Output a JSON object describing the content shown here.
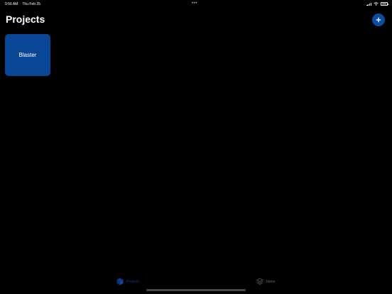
{
  "status_bar": {
    "time": "9:56 AM",
    "date": "Thu Feb 25",
    "dots": "•••",
    "battery_level": 0.9
  },
  "header": {
    "title": "Projects",
    "add_label": "+"
  },
  "projects": [
    {
      "name": "Blaster"
    }
  ],
  "tab_bar": {
    "tabs": [
      {
        "label": "Projects",
        "icon": "projects-cube-icon",
        "selected": true
      },
      {
        "label": "Items",
        "icon": "items-stack-icon",
        "selected": false
      }
    ]
  },
  "colors": {
    "accent": "#0a4ea0",
    "card": "#0a4696",
    "background": "#000000",
    "selected_tab": "#0a3f86",
    "unselected_tab": "#6b6b6b"
  }
}
